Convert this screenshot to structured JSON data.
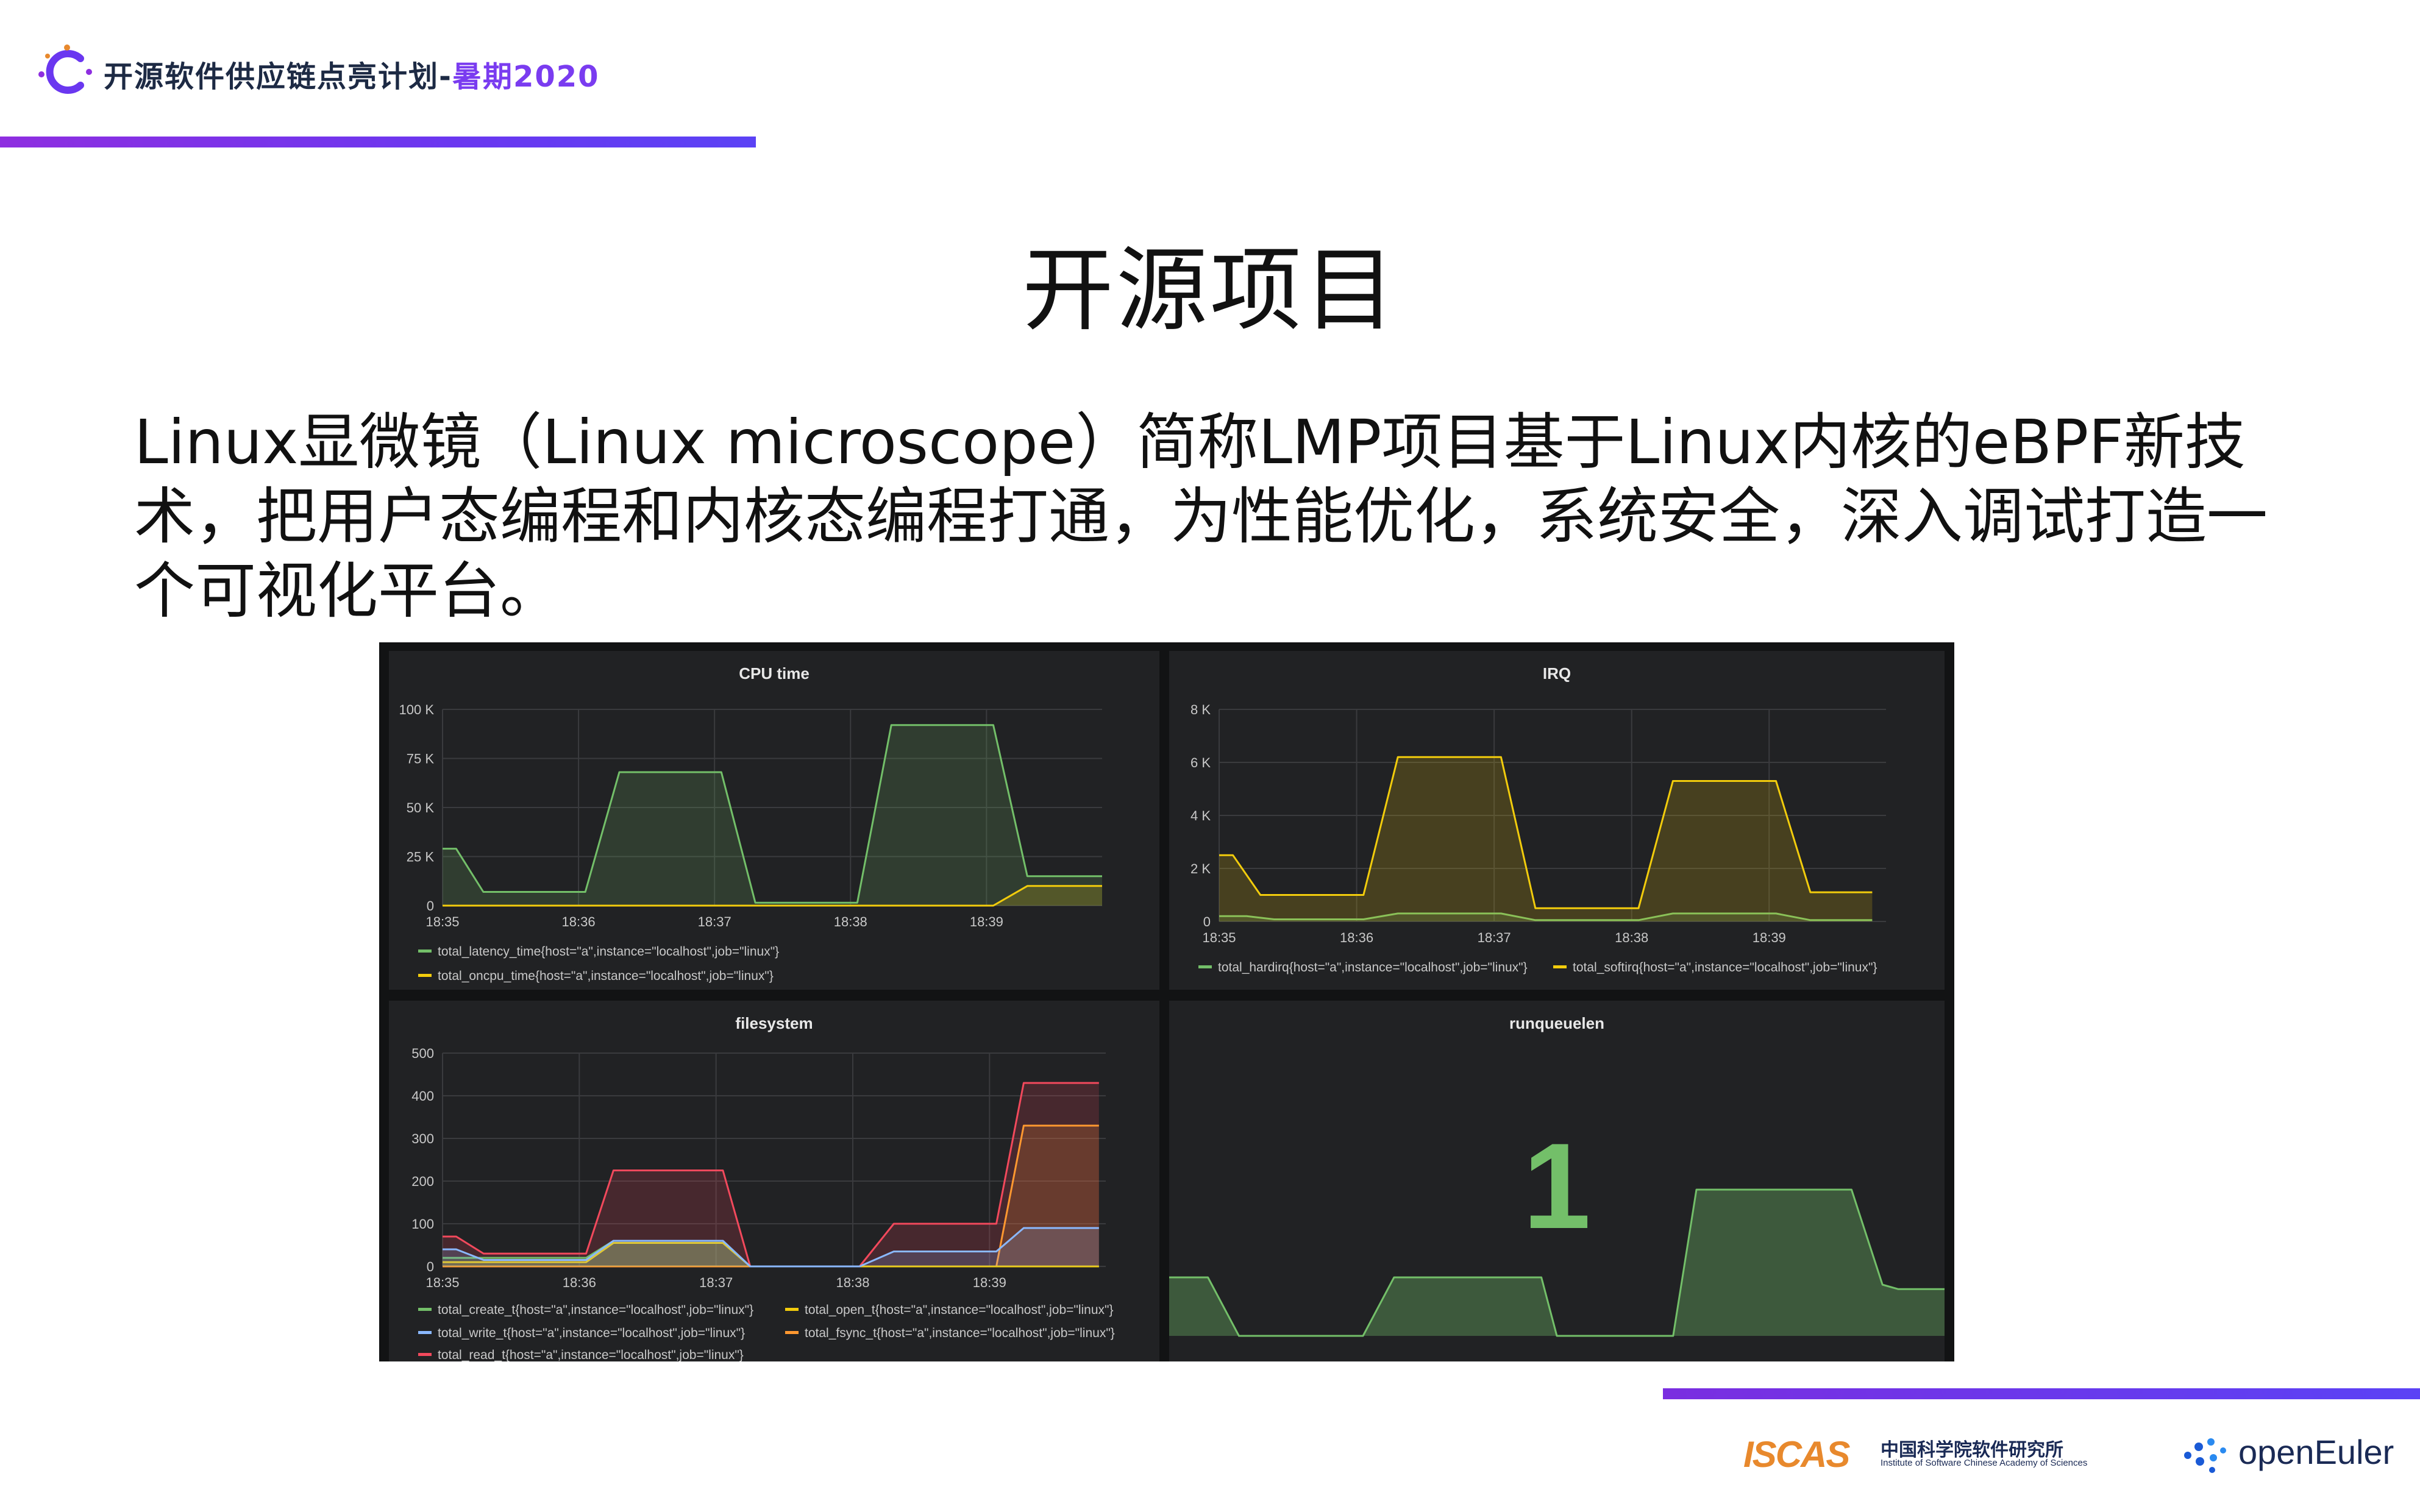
{
  "header": {
    "brand_main": "开源软件供应链点亮计划",
    "brand_dash": "-",
    "brand_accent": "暑期2020"
  },
  "title": "开源项目",
  "paragraph": "Linux显微镜（Linux microscope）简称LMP项目基于Linux内核的eBPF新技术，把用户态编程和内核态编程打通，为性能优化，系统安全，深入调试打造一个可视化平台。",
  "colors": {
    "brand_purple": "#7a3cf0",
    "green": "#73bf69",
    "yellow": "#f2cc0c",
    "blue": "#8ab8ff",
    "orange": "#ff9830",
    "red": "#f2495c",
    "panel_bg": "#212224",
    "dashboard_bg": "#121314"
  },
  "dashboard": {
    "cpu": {
      "title": "CPU time",
      "legend": [
        "total_latency_time{host=\"a\",instance=\"localhost\",job=\"linux\"}",
        "total_oncpu_time{host=\"a\",instance=\"localhost\",job=\"linux\"}"
      ]
    },
    "irq": {
      "title": "IRQ",
      "legend": [
        "total_hardirq{host=\"a\",instance=\"localhost\",job=\"linux\"}",
        "total_softirq{host=\"a\",instance=\"localhost\",job=\"linux\"}"
      ]
    },
    "fs": {
      "title": "filesystem",
      "legend": [
        "total_create_t{host=\"a\",instance=\"localhost\",job=\"linux\"}",
        "total_open_t{host=\"a\",instance=\"localhost\",job=\"linux\"}",
        "total_write_t{host=\"a\",instance=\"localhost\",job=\"linux\"}",
        "total_fsync_t{host=\"a\",instance=\"localhost\",job=\"linux\"}",
        "total_read_t{host=\"a\",instance=\"localhost\",job=\"linux\"}"
      ]
    },
    "runq": {
      "title": "runqueuelen",
      "value": "1"
    }
  },
  "chart_data": [
    {
      "type": "area",
      "title": "CPU time",
      "x": [
        "18:35",
        "18:36",
        "18:37",
        "18:38",
        "18:39"
      ],
      "x_range": [
        0,
        4.85
      ],
      "ylim": [
        0,
        100000
      ],
      "y_ticks": [
        "0",
        "25 K",
        "50 K",
        "75 K",
        "100 K"
      ],
      "series": [
        {
          "name": "total_latency_time{host=\"a\",instance=\"localhost\",job=\"linux\"}",
          "color": "#73bf69",
          "points": [
            [
              0,
              29000
            ],
            [
              0.1,
              29000
            ],
            [
              0.3,
              7000
            ],
            [
              1.05,
              7000
            ],
            [
              1.3,
              68000
            ],
            [
              2.05,
              68000
            ],
            [
              2.3,
              1500
            ],
            [
              3.05,
              1500
            ],
            [
              3.3,
              92000
            ],
            [
              4.05,
              92000
            ],
            [
              4.3,
              15000
            ],
            [
              4.85,
              15000
            ]
          ]
        },
        {
          "name": "total_oncpu_time{host=\"a\",instance=\"localhost\",job=\"linux\"}",
          "color": "#f2cc0c",
          "points": [
            [
              0,
              0
            ],
            [
              4.05,
              0
            ],
            [
              4.3,
              10000
            ],
            [
              4.85,
              10000
            ]
          ]
        }
      ],
      "grid": true,
      "legend": "bottom"
    },
    {
      "type": "area",
      "title": "IRQ",
      "x": [
        "18:35",
        "18:36",
        "18:37",
        "18:38",
        "18:39"
      ],
      "x_range": [
        0,
        4.85
      ],
      "ylim": [
        0,
        8000
      ],
      "y_ticks": [
        "0",
        "2 K",
        "4 K",
        "6 K",
        "8 K"
      ],
      "series": [
        {
          "name": "total_hardirq{host=\"a\",instance=\"localhost\",job=\"linux\"}",
          "color": "#73bf69",
          "points": [
            [
              0,
              200
            ],
            [
              0.2,
              200
            ],
            [
              0.4,
              80
            ],
            [
              1.05,
              80
            ],
            [
              1.3,
              300
            ],
            [
              2.05,
              300
            ],
            [
              2.3,
              50
            ],
            [
              3.05,
              50
            ],
            [
              3.3,
              300
            ],
            [
              4.05,
              300
            ],
            [
              4.3,
              50
            ],
            [
              4.75,
              50
            ]
          ]
        },
        {
          "name": "total_softirq{host=\"a\",instance=\"localhost\",job=\"linux\"}",
          "color": "#f2cc0c",
          "points": [
            [
              0,
              2500
            ],
            [
              0.1,
              2500
            ],
            [
              0.3,
              1000
            ],
            [
              1.05,
              1000
            ],
            [
              1.3,
              6200
            ],
            [
              2.05,
              6200
            ],
            [
              2.3,
              500
            ],
            [
              3.05,
              500
            ],
            [
              3.3,
              5300
            ],
            [
              4.05,
              5300
            ],
            [
              4.3,
              1100
            ],
            [
              4.75,
              1100
            ]
          ]
        }
      ],
      "grid": true,
      "legend": "bottom"
    },
    {
      "type": "area",
      "title": "filesystem",
      "x": [
        "18:35",
        "18:36",
        "18:37",
        "18:38",
        "18:39"
      ],
      "x_range": [
        0,
        4.85
      ],
      "ylim": [
        0,
        500
      ],
      "y_ticks": [
        "0",
        "100",
        "200",
        "300",
        "400",
        "500"
      ],
      "series": [
        {
          "name": "total_read_t{host=\"a\",instance=\"localhost\",job=\"linux\"}",
          "color": "#f2495c",
          "points": [
            [
              0,
              70
            ],
            [
              0.1,
              70
            ],
            [
              0.3,
              30
            ],
            [
              1.05,
              30
            ],
            [
              1.25,
              225
            ],
            [
              2.05,
              225
            ],
            [
              2.25,
              0
            ],
            [
              3.05,
              0
            ],
            [
              3.3,
              100
            ],
            [
              4.05,
              100
            ],
            [
              4.25,
              430
            ],
            [
              4.8,
              430
            ]
          ]
        },
        {
          "name": "total_fsync_t{host=\"a\",instance=\"localhost\",job=\"linux\"}",
          "color": "#ff9830",
          "points": [
            [
              0,
              0
            ],
            [
              4.05,
              0
            ],
            [
              4.25,
              330
            ],
            [
              4.8,
              330
            ]
          ]
        },
        {
          "name": "total_create_t{host=\"a\",instance=\"localhost\",job=\"linux\"}",
          "color": "#73bf69",
          "points": [
            [
              0,
              20
            ],
            [
              0.3,
              20
            ],
            [
              1.05,
              20
            ],
            [
              1.25,
              60
            ],
            [
              2.05,
              60
            ],
            [
              2.25,
              0
            ],
            [
              4.8,
              0
            ]
          ]
        },
        {
          "name": "total_open_t{host=\"a\",instance=\"localhost\",job=\"linux\"}",
          "color": "#f2cc0c",
          "points": [
            [
              0,
              10
            ],
            [
              0.3,
              10
            ],
            [
              1.05,
              10
            ],
            [
              1.25,
              55
            ],
            [
              2.05,
              55
            ],
            [
              2.25,
              0
            ],
            [
              4.8,
              0
            ]
          ]
        },
        {
          "name": "total_write_t{host=\"a\",instance=\"localhost\",job=\"linux\"}",
          "color": "#8ab8ff",
          "points": [
            [
              0,
              40
            ],
            [
              0.1,
              40
            ],
            [
              0.3,
              15
            ],
            [
              1.05,
              15
            ],
            [
              1.25,
              60
            ],
            [
              2.05,
              60
            ],
            [
              2.25,
              0
            ],
            [
              3.05,
              0
            ],
            [
              3.3,
              35
            ],
            [
              4.05,
              35
            ],
            [
              4.25,
              90
            ],
            [
              4.8,
              90
            ]
          ]
        }
      ],
      "grid": true,
      "legend": "bottom"
    },
    {
      "type": "area",
      "title": "runqueuelen",
      "x_range": [
        0,
        100
      ],
      "ylim": [
        0,
        100
      ],
      "series": [
        {
          "color": "#73bf69",
          "points": [
            [
              0,
              40
            ],
            [
              5,
              40
            ],
            [
              9,
              0
            ],
            [
              25,
              0
            ],
            [
              29,
              40
            ],
            [
              48,
              40
            ],
            [
              50,
              0
            ],
            [
              65,
              0
            ],
            [
              68,
              100
            ],
            [
              88,
              100
            ],
            [
              92,
              35
            ],
            [
              94,
              32
            ],
            [
              100,
              32
            ]
          ]
        }
      ],
      "grid": false
    }
  ]
}
